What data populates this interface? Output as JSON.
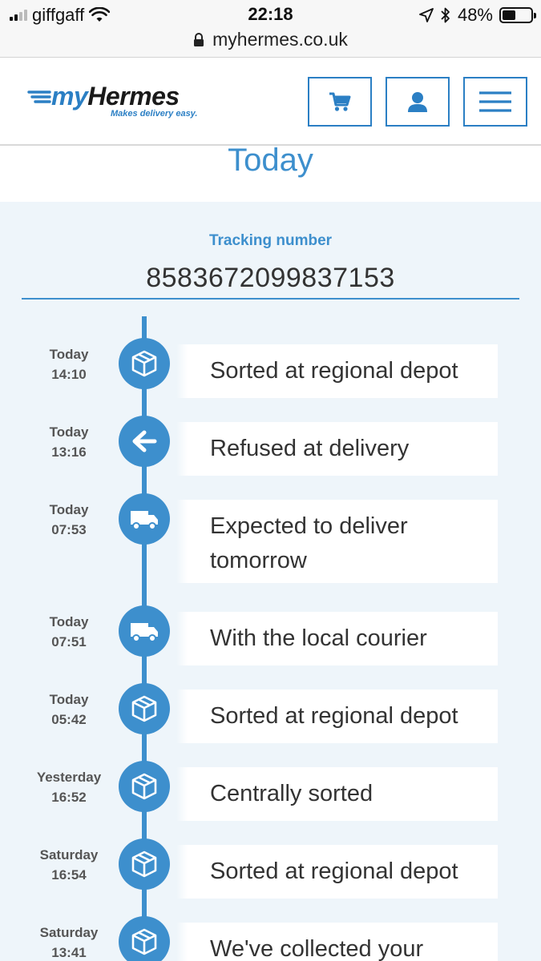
{
  "status_bar": {
    "carrier": "giffgaff",
    "time": "22:18",
    "battery": "48%",
    "battery_level": 0.48,
    "url": "myhermes.co.uk"
  },
  "header": {
    "logo_my": "my",
    "logo_hermes": "Hermes",
    "logo_tagline": "Makes delivery easy.",
    "brand_color": "#2b7fc4"
  },
  "page": {
    "heading": "Today",
    "tracking_label": "Tracking number",
    "tracking_number": "8583672099837153"
  },
  "events": [
    {
      "day": "Today",
      "time": "14:10",
      "icon": "parcel-box-icon",
      "text": "Sorted at regional depot"
    },
    {
      "day": "Today",
      "time": "13:16",
      "icon": "arrow-left-icon",
      "text": "Refused at delivery"
    },
    {
      "day": "Today",
      "time": "07:53",
      "icon": "delivery-van-icon",
      "text": "Expected to deliver tomorrow"
    },
    {
      "day": "Today",
      "time": "07:51",
      "icon": "delivery-van-icon",
      "text": "With the local courier"
    },
    {
      "day": "Today",
      "time": "05:42",
      "icon": "parcel-box-icon",
      "text": "Sorted at regional depot"
    },
    {
      "day": "Yesterday",
      "time": "16:52",
      "icon": "parcel-box-icon",
      "text": "Centrally sorted"
    },
    {
      "day": "Saturday",
      "time": "16:54",
      "icon": "parcel-box-icon",
      "text": "Sorted at regional depot"
    },
    {
      "day": "Saturday",
      "time": "13:41",
      "icon": "parcel-box-icon",
      "text": "We've collected your"
    }
  ],
  "colors": {
    "accent": "#3d8fcd",
    "background": "#eef5fa",
    "card": "#ffffff",
    "text": "#333333"
  }
}
